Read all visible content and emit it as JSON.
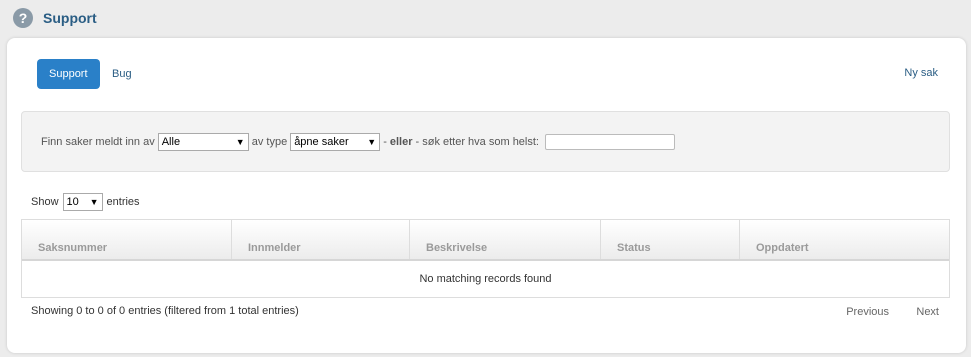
{
  "header": {
    "title": "Support",
    "icon": "question-circle-icon"
  },
  "tabs": [
    {
      "label": "Support",
      "active": true
    },
    {
      "label": "Bug",
      "active": false
    }
  ],
  "new_case_label": "Ny sak",
  "filter": {
    "prefix": "Finn saker meldt inn av",
    "reporter_value": "Alle",
    "type_label": "av type",
    "type_value": "åpne saker",
    "or_dash": "-",
    "or_label": "eller",
    "search_label": "- søk etter hva som helst:",
    "search_value": ""
  },
  "length": {
    "show": "Show",
    "value": "10",
    "entries": "entries"
  },
  "table": {
    "columns": [
      "Saksnummer",
      "Innmelder",
      "Beskrivelse",
      "Status",
      "Oppdatert"
    ],
    "empty": "No matching records found"
  },
  "footer": {
    "info": "Showing 0 to 0 of 0 entries (filtered from 1 total entries)",
    "previous": "Previous",
    "next": "Next"
  },
  "colors": {
    "accent": "#2a80c8",
    "title": "#2a5d84"
  }
}
